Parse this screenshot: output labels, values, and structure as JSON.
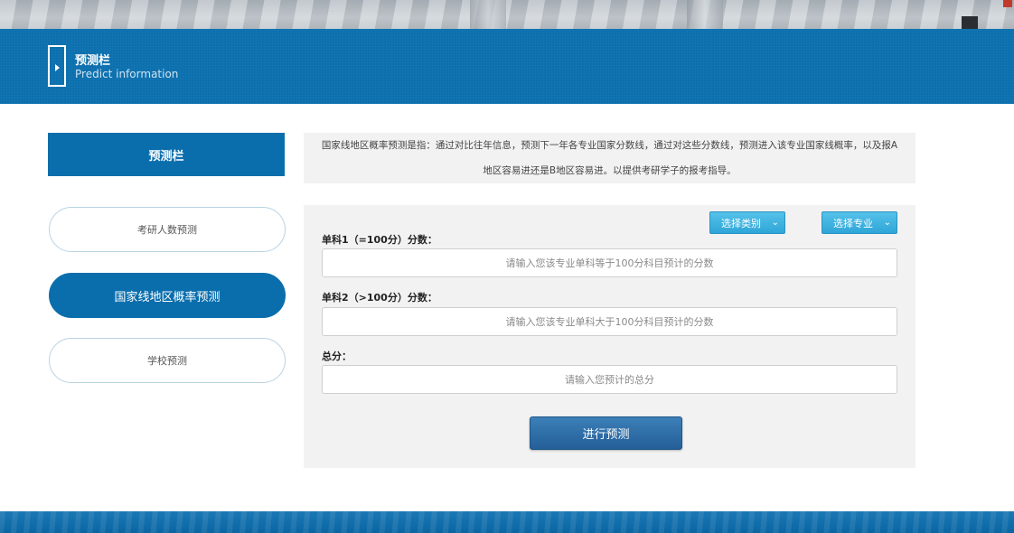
{
  "banner": {
    "title": "预测栏",
    "subtitle": "Predict information",
    "icon": "door-arrow-icon"
  },
  "sidebar": {
    "header": "预测栏",
    "items": [
      {
        "label": "考研人数预测",
        "active": false
      },
      {
        "label": "国家线地区概率预测",
        "active": true
      },
      {
        "label": "学校预测",
        "active": false
      }
    ]
  },
  "description": {
    "line1": "国家线地区概率预测是指：通过对比往年信息，预测下一年各专业国家分数线，通过对这些分数线，预测进入该专业国家线概率，以及报A",
    "line2": "地区容易进还是B地区容易进。以提供考研学子的报考指导。"
  },
  "form": {
    "select_category": "选择类别",
    "select_major": "选择专业",
    "fields": [
      {
        "label": "单科1（=100分）分数：",
        "placeholder": "请输入您该专业单科等于100分科目预计的分数",
        "value": ""
      },
      {
        "label": "单科2（>100分）分数：",
        "placeholder": "请输入您该专业单科大于100分科目预计的分数",
        "value": ""
      },
      {
        "label": "总分：",
        "placeholder": "请输入您预计的总分",
        "value": ""
      }
    ],
    "submit_label": "进行预测"
  },
  "colors": {
    "primary_blue": "#0a6ead",
    "select_blue": "#2fa6d8",
    "submit_blue": "#245f98",
    "panel_gray": "#f2f2f2"
  }
}
